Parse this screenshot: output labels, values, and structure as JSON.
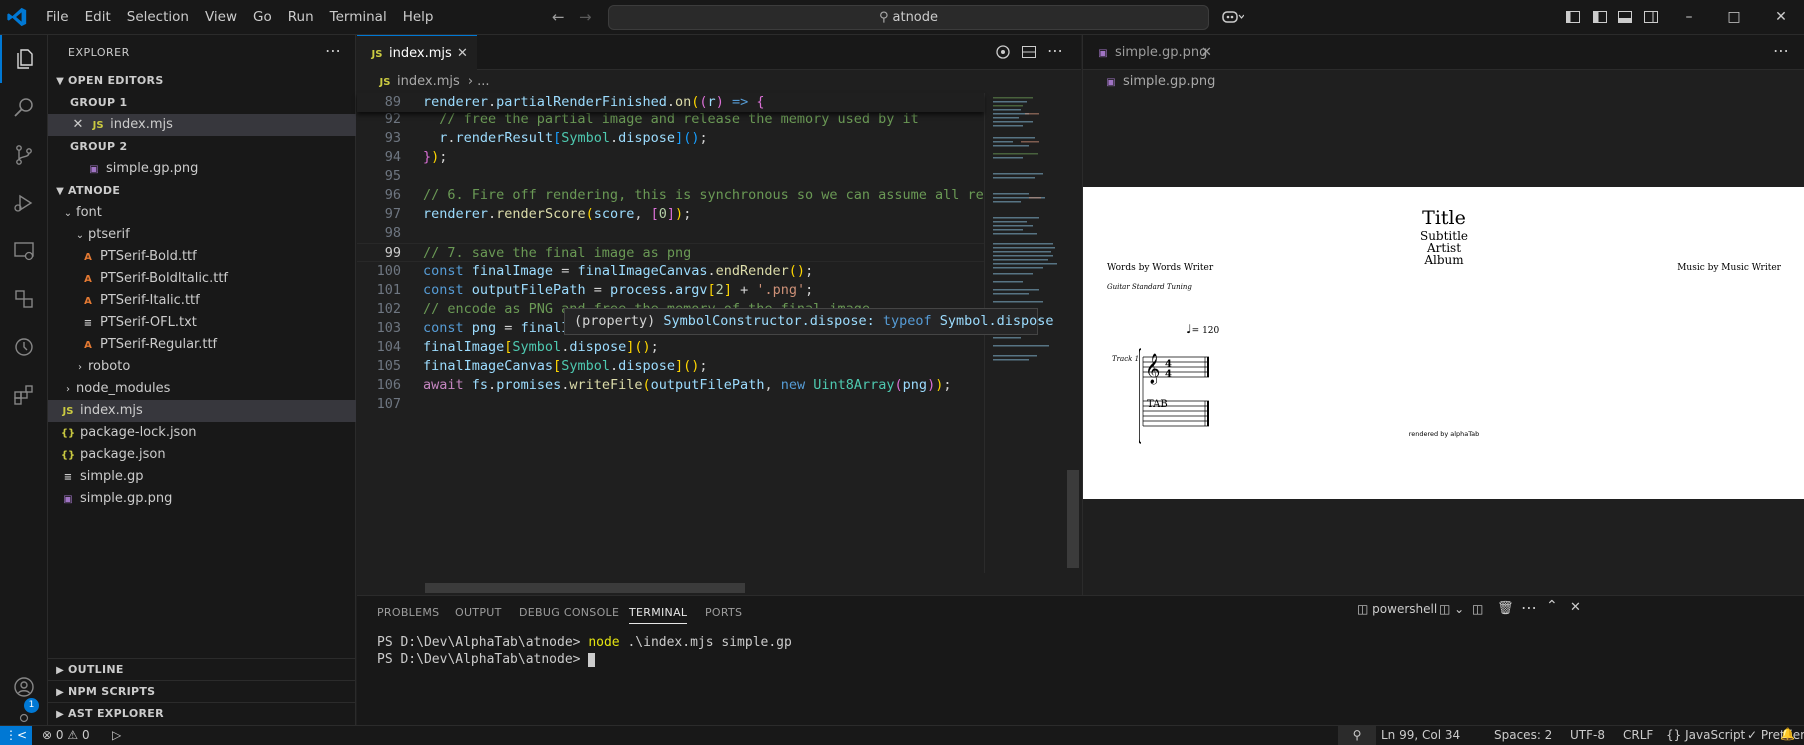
{
  "menu": [
    "File",
    "Edit",
    "Selection",
    "View",
    "Go",
    "Run",
    "Terminal",
    "Help"
  ],
  "command_center": "atnode",
  "explorer": {
    "title": "EXPLORER",
    "open_editors": "OPEN EDITORS",
    "group1": "GROUP 1",
    "group1_file": "index.mjs",
    "group2": "GROUP 2",
    "group2_file": "simple.gp.png",
    "project": "ATNODE",
    "tree": {
      "font": "font",
      "ptserif": "ptserif",
      "f1": "PTSerif-Bold.ttf",
      "f2": "PTSerif-BoldItalic.ttf",
      "f3": "PTSerif-Italic.ttf",
      "f4": "PTSerif-OFL.txt",
      "f5": "PTSerif-Regular.ttf",
      "roboto": "roboto",
      "node_modules": "node_modules",
      "index": "index.mjs",
      "lock": "package-lock.json",
      "pkg": "package.json",
      "gp": "simple.gp",
      "png": "simple.gp.png"
    },
    "outline": "OUTLINE",
    "npm": "NPM SCRIPTS",
    "ast": "AST EXPLORER"
  },
  "editor1": {
    "tab": "index.mjs",
    "breadcrumb_file": "index.mjs",
    "breadcrumb_rest": "...",
    "sticky_line": "renderer.partialRenderFinished.on((r) => {",
    "line_numbers": [
      "89",
      "92",
      "93",
      "94",
      "95",
      "96",
      "97",
      "98",
      "99",
      "100",
      "101",
      "102",
      "103",
      "104",
      "105",
      "106",
      "107"
    ],
    "hover": {
      "prefix": "(property) ",
      "signature": "SymbolConstructor.dispose: ",
      "kw": "typeof",
      "type": " Symbol.dispose"
    }
  },
  "editor2": {
    "tab": "simple.gp.png",
    "breadcrumb": "simple.gp.png",
    "score": {
      "title": "Title",
      "subtitle": "Subtitle",
      "artist": "Artist",
      "album": "Album",
      "words": "Words by Words Writer",
      "music": "Music by Music Writer",
      "tuning": "Guitar Standard Tuning",
      "tempo": "= 120",
      "track": "Track 1",
      "tab_label": "TAB",
      "footer": "rendered by alphaTab"
    }
  },
  "panel": {
    "tabs": [
      "PROBLEMS",
      "OUTPUT",
      "DEBUG CONSOLE",
      "TERMINAL",
      "PORTS"
    ],
    "shell": "powershell",
    "line1_prompt": "PS D:\\Dev\\AlphaTab\\atnode> ",
    "line1_cmd": "node",
    "line1_args": " .\\index.mjs simple.gp",
    "line2_prompt": "PS D:\\Dev\\AlphaTab\\atnode> "
  },
  "status": {
    "errors": "0",
    "warnings": "0",
    "position": "Ln 99, Col 34",
    "spaces": "Spaces: 2",
    "encoding": "UTF-8",
    "eol": "CRLF",
    "language": "JavaScript",
    "formatter": "Prettier",
    "badge": "1"
  },
  "colors": {
    "accent": "#0078d4",
    "background": "#1f1f1f",
    "sidebar": "#181818"
  }
}
